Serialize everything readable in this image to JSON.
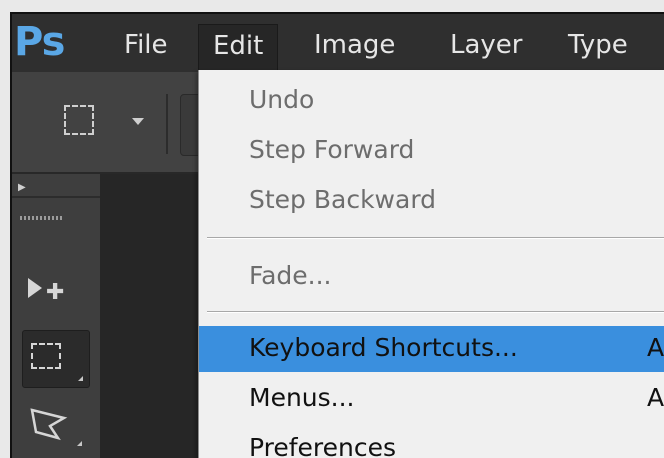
{
  "app": {
    "logo": "Ps"
  },
  "menubar": {
    "items": [
      {
        "label": "File"
      },
      {
        "label": "Edit"
      },
      {
        "label": "Image"
      },
      {
        "label": "Layer"
      },
      {
        "label": "Type"
      }
    ],
    "active": "Edit"
  },
  "options_bar": {
    "tool_icon": "rectangular-marquee-icon",
    "dropdown_icon": "chevron-down-icon"
  },
  "tools": [
    {
      "name": "move-tool",
      "icon": "move-icon"
    },
    {
      "name": "rectangular-marquee-tool",
      "icon": "rectangular-marquee-icon",
      "selected": true
    },
    {
      "name": "lasso-tool",
      "icon": "polygonal-lasso-icon"
    }
  ],
  "edit_menu": {
    "items": [
      {
        "label": "Undo",
        "disabled": true
      },
      {
        "label": "Step Forward",
        "disabled": true
      },
      {
        "label": "Step Backward",
        "disabled": true
      },
      {
        "label": "Fade...",
        "disabled": true
      },
      {
        "label": "Keyboard Shortcuts...",
        "shortcut": "A",
        "highlighted": true
      },
      {
        "label": "Menus...",
        "shortcut": "Alt"
      },
      {
        "label": "Preferences"
      }
    ]
  },
  "colors": {
    "accent": "#3a8fde",
    "logo": "#5aa7e6",
    "menubar_bg": "#2f2f2f"
  }
}
